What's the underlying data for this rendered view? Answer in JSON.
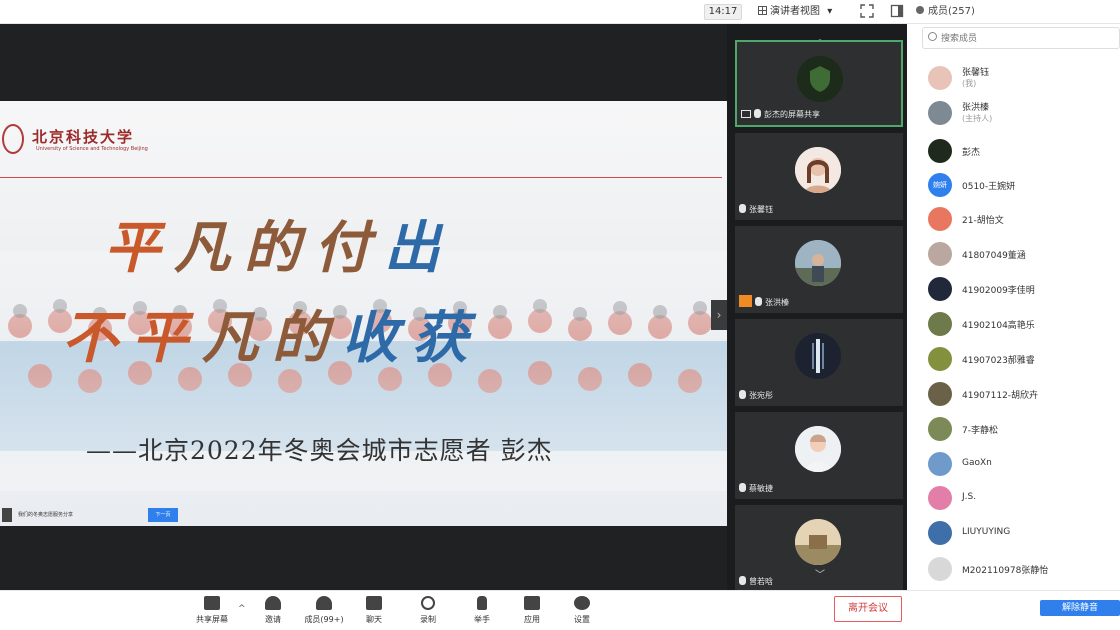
{
  "topbar": {
    "time": "14:17",
    "view_label": "演讲者视图",
    "view_caret": "▾",
    "members_label": "成员(257)"
  },
  "slide": {
    "logo_cn": "北京科技大学",
    "logo_en": "University of Science and Technology Beijing",
    "line1": [
      "平",
      "凡",
      "的",
      "付",
      "出"
    ],
    "line2": [
      "不",
      "平",
      "凡",
      "的",
      "收",
      "获"
    ],
    "signature": "——北京2022年冬奥会城市志愿者  彭杰",
    "doc_name": "我们的冬奥志愿服务分享",
    "next_label": "下一页"
  },
  "video_tiles": [
    {
      "label": "彭杰的屏幕共享",
      "icon": "screen-share"
    },
    {
      "label": "张馨钰",
      "icon": "mic"
    },
    {
      "label": "张洪榛",
      "icon": "host"
    },
    {
      "label": "张宛彤",
      "icon": "mic"
    },
    {
      "label": "蔡敏捷",
      "icon": "mic"
    },
    {
      "label": "曾若晗",
      "icon": "mic"
    }
  ],
  "search": {
    "placeholder": "搜索成员"
  },
  "members": [
    {
      "name": "张馨钰",
      "sub": "(我)",
      "color": "#e8c3b8"
    },
    {
      "name": "张洪榛",
      "sub": "(主持人)",
      "color": "#7d8a94"
    },
    {
      "name": "彭杰",
      "sub": "",
      "color": "#1f2a1c"
    },
    {
      "name": "0510-王婉妍",
      "sub": "",
      "color": "#2f80ed",
      "initials": "婉妍"
    },
    {
      "name": "21-胡怡文",
      "sub": "",
      "color": "#e9775f"
    },
    {
      "name": "41807049董涵",
      "sub": "",
      "color": "#b9a7a0"
    },
    {
      "name": "41902009李佳明",
      "sub": "",
      "color": "#20283a"
    },
    {
      "name": "41902104高艳乐",
      "sub": "",
      "color": "#6d7a4a"
    },
    {
      "name": "41907023郝雅睿",
      "sub": "",
      "color": "#83913f"
    },
    {
      "name": "41907112-胡欣卉",
      "sub": "",
      "color": "#6b6048"
    },
    {
      "name": "7-李静松",
      "sub": "",
      "color": "#7b8a56"
    },
    {
      "name": "GaoXn",
      "sub": "",
      "color": "#6f9ac9"
    },
    {
      "name": "J.S.",
      "sub": "",
      "color": "#e27ea8"
    },
    {
      "name": "LIUYUYING",
      "sub": "",
      "color": "#3f6fa8"
    },
    {
      "name": "M202110978张静怡",
      "sub": "",
      "color": "#d8d8d8"
    }
  ],
  "toolbar": [
    {
      "label": "共享屏幕",
      "icon": "share-screen-icon"
    },
    {
      "label": "邀请",
      "icon": "invite-icon"
    },
    {
      "label": "成员(99+)",
      "icon": "members-icon"
    },
    {
      "label": "聊天",
      "icon": "chat-icon"
    },
    {
      "label": "录制",
      "icon": "record-icon"
    },
    {
      "label": "举手",
      "icon": "raise-hand-icon"
    },
    {
      "label": "应用",
      "icon": "apps-icon"
    },
    {
      "label": "设置",
      "icon": "settings-icon"
    }
  ],
  "leave_label": "离开会议",
  "unmute_label": "解除静音",
  "colors": {
    "accent": "#2f80ed",
    "danger": "#d33a3a",
    "speaker_border": "#4fa86b"
  }
}
